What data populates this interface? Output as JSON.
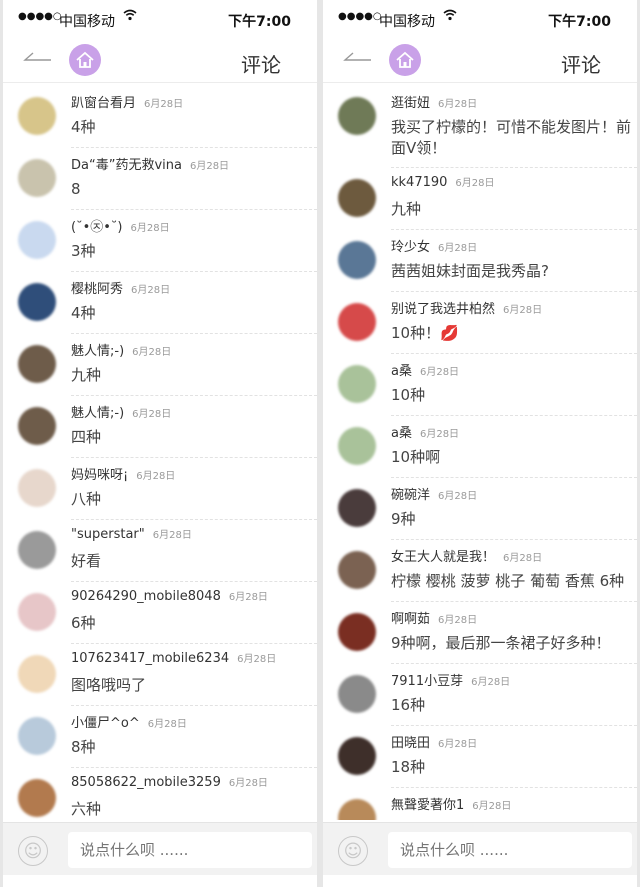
{
  "status": {
    "carrier": "中国移动",
    "time": "下午7:00"
  },
  "nav": {
    "title": "评论"
  },
  "composer": {
    "placeholder": "说点什么呗 ......"
  },
  "left_comments": [
    {
      "user": "趴窗台看月",
      "date": "6月28日",
      "text": "4种",
      "avatar_color": "#d7c58a"
    },
    {
      "user": "Da“毒”药无救vina",
      "date": "6月28日",
      "text": "8",
      "avatar_color": "#c9c3ad"
    },
    {
      "user": "(˘•㉨•˘)",
      "date": "6月28日",
      "text": "3种",
      "avatar_color": "#c9d9ef"
    },
    {
      "user": "樱桃阿秀",
      "date": "6月28日",
      "text": "4种",
      "avatar_color": "#2f4e7a"
    },
    {
      "user": "魅人情;-)",
      "date": "6月28日",
      "text": "九种",
      "avatar_color": "#6e5c4a"
    },
    {
      "user": "魅人情;-)",
      "date": "6月28日",
      "text": "四种",
      "avatar_color": "#6e5c4a"
    },
    {
      "user": "妈妈咪呀¡",
      "date": "6月28日",
      "text": "八种",
      "avatar_color": "#e7d7cc"
    },
    {
      "user": "\"superstar\"",
      "date": "6月28日",
      "text": "好看",
      "avatar_color": "#9a9a9a"
    },
    {
      "user": "90264290_mobile8048",
      "date": "6月28日",
      "text": "6种",
      "avatar_color": "#e7c6c8"
    },
    {
      "user": "107623417_mobile6234",
      "date": "6月28日",
      "text": "图咯哦吗了",
      "avatar_color": "#f0d8b8"
    },
    {
      "user": "小僵尸^o^",
      "date": "6月28日",
      "text": "8种",
      "avatar_color": "#b8cadb"
    },
    {
      "user": "85058622_mobile3259",
      "date": "6月28日",
      "text": "六种",
      "avatar_color": "#b27a4e"
    }
  ],
  "right_comments": [
    {
      "user": "逛街妞",
      "date": "6月28日",
      "text": "我买了柠檬的！可惜不能发图片！前面V领！",
      "avatar_color": "#6f7a57",
      "tall": true
    },
    {
      "user": "kk47190",
      "date": "6月28日",
      "text": "九种",
      "avatar_color": "#6d5a3e"
    },
    {
      "user": "玲少女",
      "date": "6月28日",
      "text": "茜茜姐妹封面是我秀晶?",
      "avatar_color": "#5a7796"
    },
    {
      "user": "别说了我选井柏然",
      "date": "6月28日",
      "text": "10种！💋",
      "avatar_color": "#d64a4a"
    },
    {
      "user": "a桑",
      "date": "6月28日",
      "text": "10种",
      "avatar_color": "#a9c29a"
    },
    {
      "user": "a桑",
      "date": "6月28日",
      "text": "10种啊",
      "avatar_color": "#a9c29a"
    },
    {
      "user": "碗碗洋",
      "date": "6月28日",
      "text": "9种",
      "avatar_color": "#4a3c3c"
    },
    {
      "user": "女王大人就是我！",
      "date": "6月28日",
      "text": "柠檬 樱桃 菠萝 桃子 葡萄 香蕉 6种",
      "avatar_color": "#7b6252"
    },
    {
      "user": "啊啊茹",
      "date": "6月28日",
      "text": "9种啊，最后那一条裙子好多种！",
      "avatar_color": "#7a2e22"
    },
    {
      "user": "7911小豆芽",
      "date": "6月28日",
      "text": "16种",
      "avatar_color": "#8a8a8a"
    },
    {
      "user": "田晓田",
      "date": "6月28日",
      "text": "18种",
      "avatar_color": "#3e2f2a"
    },
    {
      "user": "無聲愛著你1",
      "date": "6月28日",
      "text": "",
      "avatar_color": "#b88a5a"
    }
  ]
}
